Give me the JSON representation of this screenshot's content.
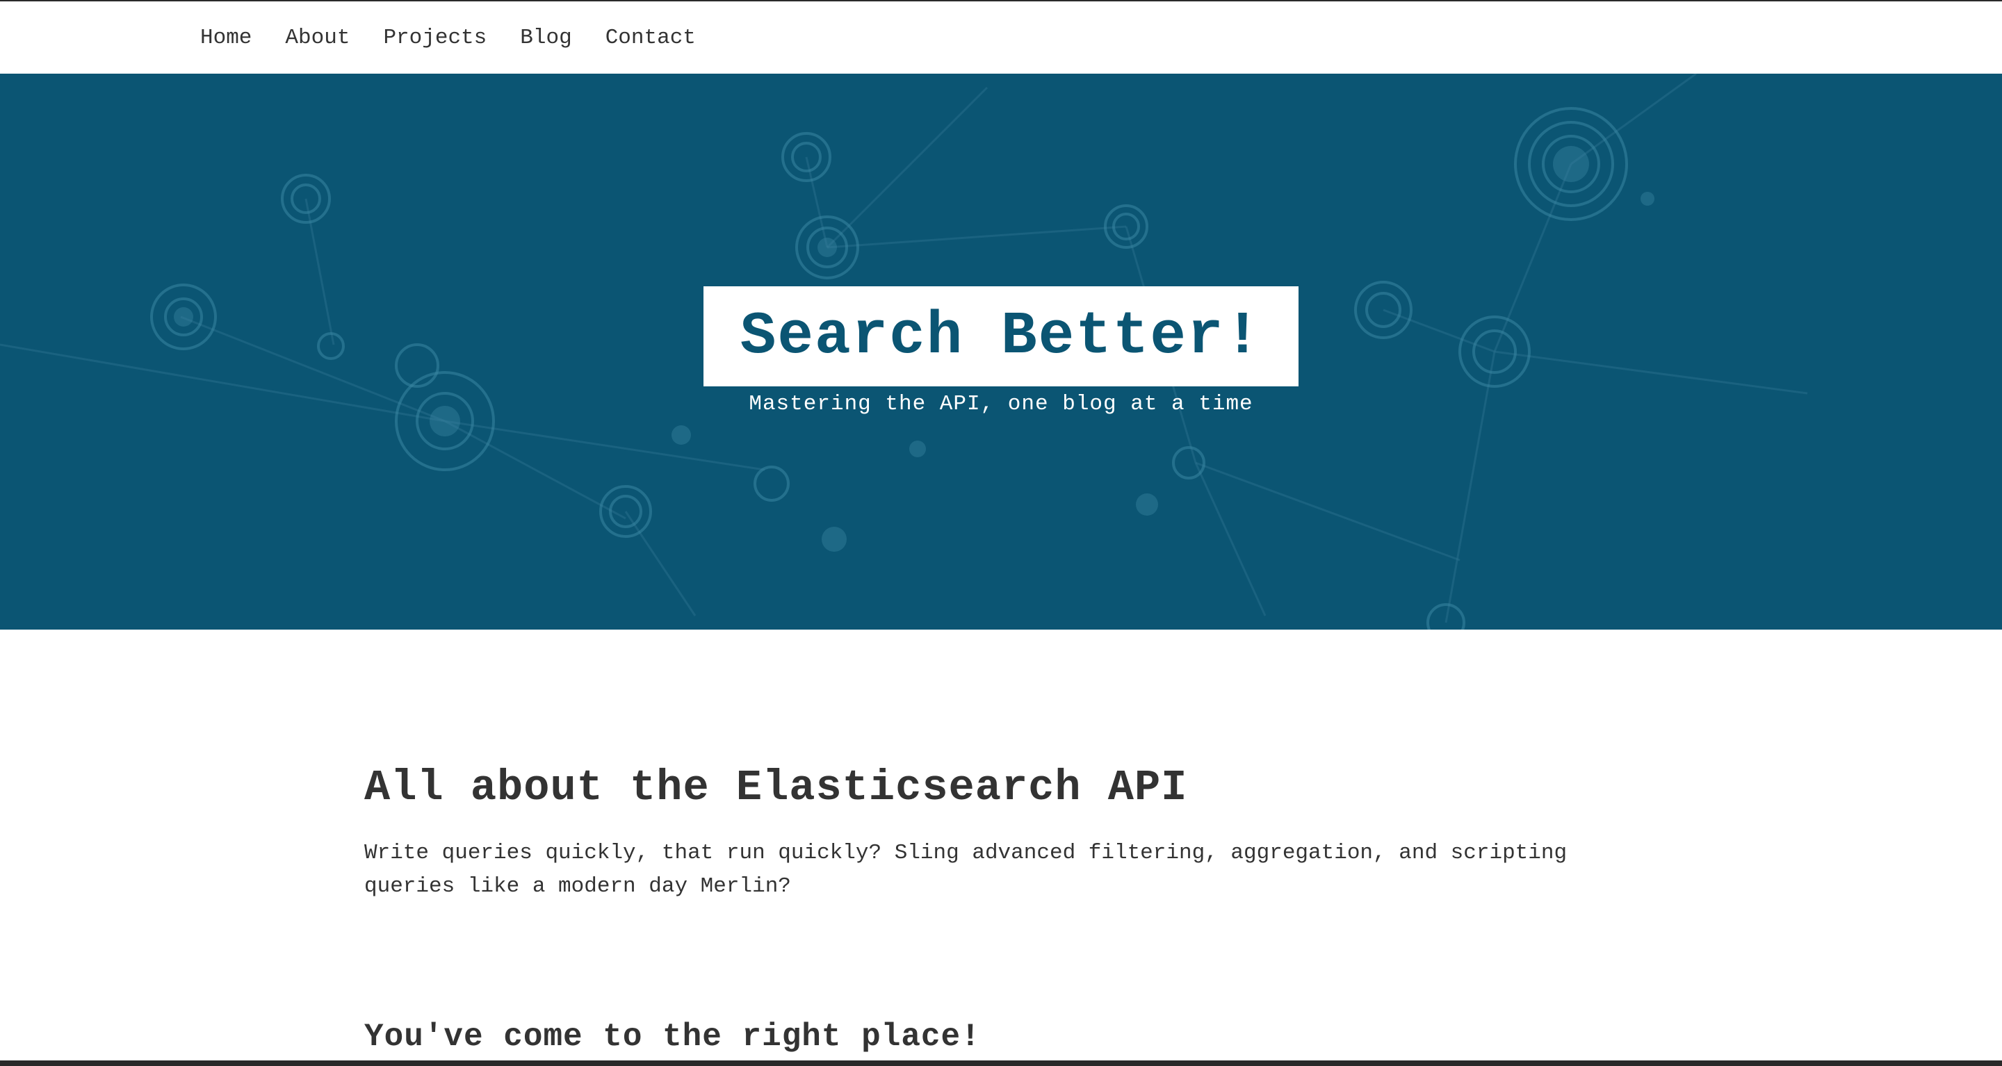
{
  "nav": {
    "items": [
      {
        "label": "Home"
      },
      {
        "label": "About"
      },
      {
        "label": "Projects"
      },
      {
        "label": "Blog"
      },
      {
        "label": "Contact"
      }
    ]
  },
  "hero": {
    "title": "Search Better!",
    "subtitle": "Mastering the API, one blog at a time"
  },
  "content": {
    "heading": "All about the Elasticsearch API",
    "body": "Write queries quickly, that run quickly? Sling advanced filtering, aggregation, and scripting queries like a modern day Merlin?",
    "subheading": "You've come to the right place!"
  },
  "colors": {
    "hero_background": "#0b5573",
    "hero_title_text": "#0b5573",
    "text": "#333333"
  }
}
